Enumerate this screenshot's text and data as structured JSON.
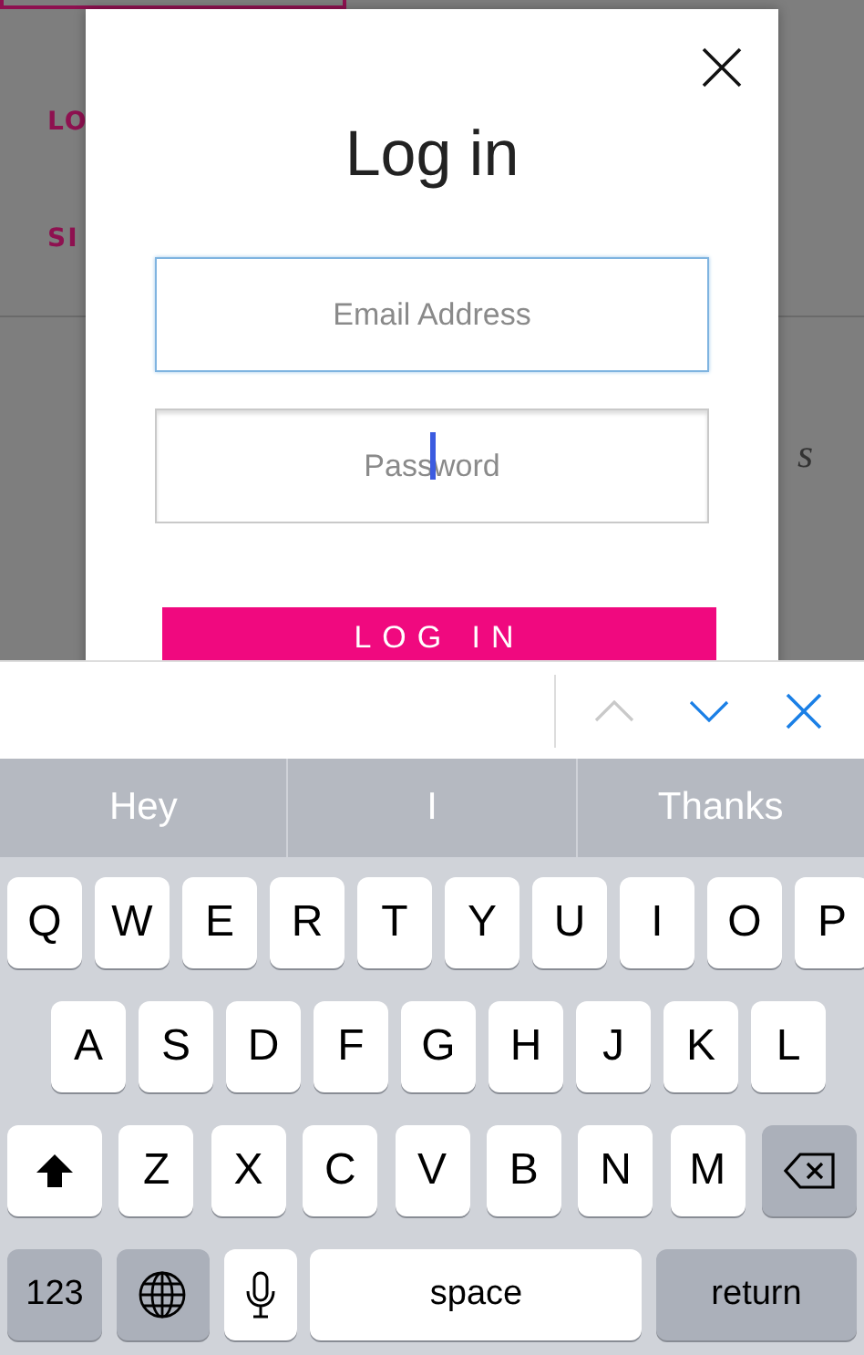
{
  "background_page": {
    "nav_items": [
      "LO",
      "SI"
    ],
    "fragments": [
      "s"
    ]
  },
  "dialog": {
    "title": "Log in",
    "fields": [
      {
        "placeholder": "Email Address",
        "focused": true,
        "caret": false
      },
      {
        "placeholder": "Password",
        "focused": false,
        "caret": true
      }
    ],
    "submit": "LOG IN"
  },
  "keyboard_toolbar": [
    {
      "kind": "up",
      "disabled": true
    },
    {
      "kind": "down",
      "disabled": false
    },
    {
      "kind": "close",
      "disabled": false
    }
  ],
  "suggestions": [
    "Hey",
    "I",
    "Thanks"
  ],
  "keyboard_rows": [
    [
      {
        "kind": "letter",
        "label": "Q"
      },
      {
        "kind": "letter",
        "label": "W"
      },
      {
        "kind": "letter",
        "label": "E"
      },
      {
        "kind": "letter",
        "label": "R"
      },
      {
        "kind": "letter",
        "label": "T"
      },
      {
        "kind": "letter",
        "label": "Y"
      },
      {
        "kind": "letter",
        "label": "U"
      },
      {
        "kind": "letter",
        "label": "I"
      },
      {
        "kind": "letter",
        "label": "O"
      },
      {
        "kind": "letter",
        "label": "P"
      }
    ],
    [
      {
        "kind": "letter",
        "label": "A"
      },
      {
        "kind": "letter",
        "label": "S"
      },
      {
        "kind": "letter",
        "label": "D"
      },
      {
        "kind": "letter",
        "label": "F"
      },
      {
        "kind": "letter",
        "label": "G"
      },
      {
        "kind": "letter",
        "label": "H"
      },
      {
        "kind": "letter",
        "label": "J"
      },
      {
        "kind": "letter",
        "label": "K"
      },
      {
        "kind": "letter",
        "label": "L"
      }
    ],
    [
      {
        "kind": "shift"
      },
      {
        "kind": "letter",
        "label": "Z"
      },
      {
        "kind": "letter",
        "label": "X"
      },
      {
        "kind": "letter",
        "label": "C"
      },
      {
        "kind": "letter",
        "label": "V"
      },
      {
        "kind": "letter",
        "label": "B"
      },
      {
        "kind": "letter",
        "label": "N"
      },
      {
        "kind": "letter",
        "label": "M"
      },
      {
        "kind": "delete"
      }
    ],
    [
      {
        "kind": "function",
        "label": "123"
      },
      {
        "kind": "globe"
      },
      {
        "kind": "mic"
      },
      {
        "kind": "space",
        "label": "space"
      },
      {
        "kind": "return",
        "label": "return"
      }
    ]
  ]
}
